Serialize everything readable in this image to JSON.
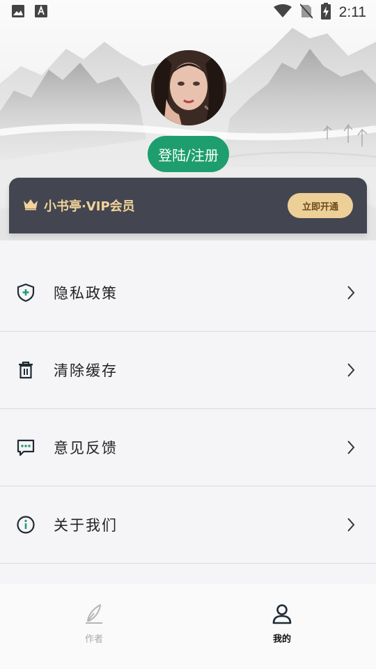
{
  "status_bar": {
    "time": "2:11",
    "icons_left": [
      "image-icon",
      "font-icon"
    ],
    "icons_right": [
      "wifi-icon",
      "no-sim-icon",
      "battery-charging-icon"
    ]
  },
  "profile": {
    "login_label": "登陆/注册"
  },
  "vip": {
    "title": "小书亭·VIP会员",
    "button_label": "立即开通",
    "icon": "crown-icon"
  },
  "menu": {
    "items": [
      {
        "label": "隐私政策",
        "icon": "shield-plus-icon"
      },
      {
        "label": "清除缓存",
        "icon": "trash-icon"
      },
      {
        "label": "意见反馈",
        "icon": "feedback-icon"
      },
      {
        "label": "关于我们",
        "icon": "info-icon"
      }
    ]
  },
  "tabbar": {
    "tabs": [
      {
        "label": "作者",
        "icon": "pen-icon",
        "active": false
      },
      {
        "label": "我的",
        "icon": "person-icon",
        "active": true
      }
    ]
  },
  "colors": {
    "accent_green": "#1e9e6e",
    "vip_bg": "#434650",
    "vip_gold": "#f2d39a",
    "vip_button": "#edcf98"
  }
}
